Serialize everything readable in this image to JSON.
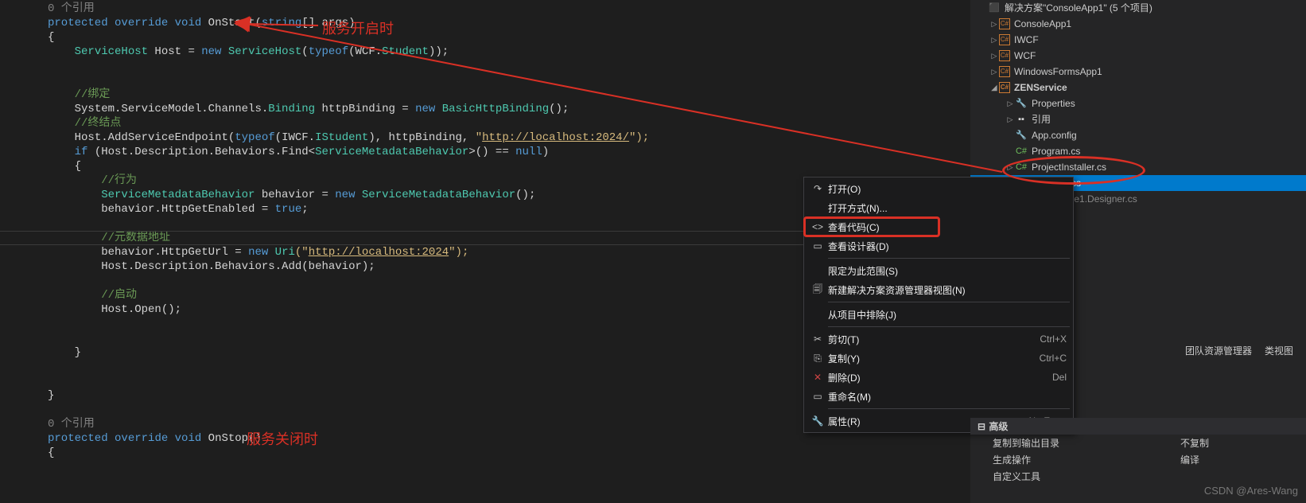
{
  "code": {
    "ref1": "0 个引用",
    "l1_protected": "protected",
    "l1_override": "override",
    "l1_void": "void",
    "l1_method": "OnStart",
    "l1_paren_open": "(",
    "l1_string": "string",
    "l1_args": "[] args)",
    "l2_brace": "{",
    "l3_ServiceHost": "ServiceHost",
    "l3_Host": " Host = ",
    "l3_new": "new",
    "l3_ServiceHost2": " ServiceHost",
    "l3_paren": "(",
    "l3_typeof": "typeof",
    "l3_wcf": "(WCF.",
    "l3_Student": "Student",
    "l3_end": "));",
    "c_bind": "//绑定",
    "l5_a": "System.ServiceModel.Channels.",
    "l5_Binding": "Binding",
    "l5_b": " httpBinding = ",
    "l5_new": "new",
    "l5_BasicHttpBinding": " BasicHttpBinding",
    "l5_end": "();",
    "c_endpoint": "//终结点",
    "l7_a": "Host.AddServiceEndpoint(",
    "l7_typeof": "typeof",
    "l7_b": "(IWCF.",
    "l7_IStudent": "IStudent",
    "l7_c": "), httpBinding, ",
    "l7_url_q": "\"",
    "l7_url": "http://localhost:2024/",
    "l7_end": "\");",
    "l8_if": "if",
    "l8_a": " (Host.Description.Behaviors.Find<",
    "l8_SMB": "ServiceMetadataBehavior",
    "l8_b": ">() == ",
    "l8_null": "null",
    "l8_c": ")",
    "l9_brace": "{",
    "c_behavior": "//行为",
    "l11_SMB": "ServiceMetadataBehavior",
    "l11_a": " behavior = ",
    "l11_new": "new",
    "l11_SMB2": " ServiceMetadataBehavior",
    "l11_end": "();",
    "l12_a": "behavior.HttpGetEnabled = ",
    "l12_true": "true",
    "l12_end": ";",
    "c_meta": "//元数据地址",
    "l14_a": "behavior.HttpGetUrl = ",
    "l14_new": "new",
    "l14_Uri": " Uri",
    "l14_q": "(\"",
    "l14_url": "http://localhost:2024",
    "l14_end": "\");",
    "l15_a": "Host.Description.Behaviors.Add(behavior);",
    "c_start": "//启动",
    "l17_a": "Host.Open();",
    "l18_brace": "}",
    "l19_brace": "}",
    "ref2": "0 个引用",
    "l21_protected": "protected",
    "l21_override": "override",
    "l21_void": "void",
    "l21_method": "OnStop",
    "l21_end": "()",
    "l22_brace": "{"
  },
  "annotations": {
    "onstart": "服务开启时",
    "onstop": "服务关闭时"
  },
  "tree": {
    "solution": "解决方案\"ConsoleApp1\" (5 个项目)",
    "p1": "ConsoleApp1",
    "p2": "IWCF",
    "p3": "WCF",
    "p4": "WindowsFormsApp1",
    "p5": "ZENService",
    "props": "Properties",
    "refs": "引用",
    "appconfig": "App.config",
    "program": "Program.cs",
    "installer": "ProjectInstaller.cs",
    "service1": "Service1.cs",
    "designer": "Service1.Designer.cs"
  },
  "menu": {
    "open": "打开(O)",
    "openwith": "打开方式(N)...",
    "viewcode": "查看代码(C)",
    "viewdesigner": "查看设计器(D)",
    "scope": "限定为此范围(S)",
    "newview": "新建解决方案资源管理器视图(N)",
    "exclude": "从项目中排除(J)",
    "cut": "剪切(T)",
    "cut_sc": "Ctrl+X",
    "copy": "复制(Y)",
    "copy_sc": "Ctrl+C",
    "delete": "删除(D)",
    "delete_sc": "Del",
    "rename": "重命名(M)",
    "properties": "属性(R)",
    "properties_sc": "Alt+Enter"
  },
  "tabs": {
    "t1": "团队资源管理器",
    "t2": "类视图"
  },
  "propspanel": {
    "group": "高级",
    "k1": "复制到输出目录",
    "v1": "不复制",
    "k2": "生成操作",
    "v2": "编译",
    "k3": "自定义工具"
  },
  "watermark": "CSDN @Ares-Wang"
}
